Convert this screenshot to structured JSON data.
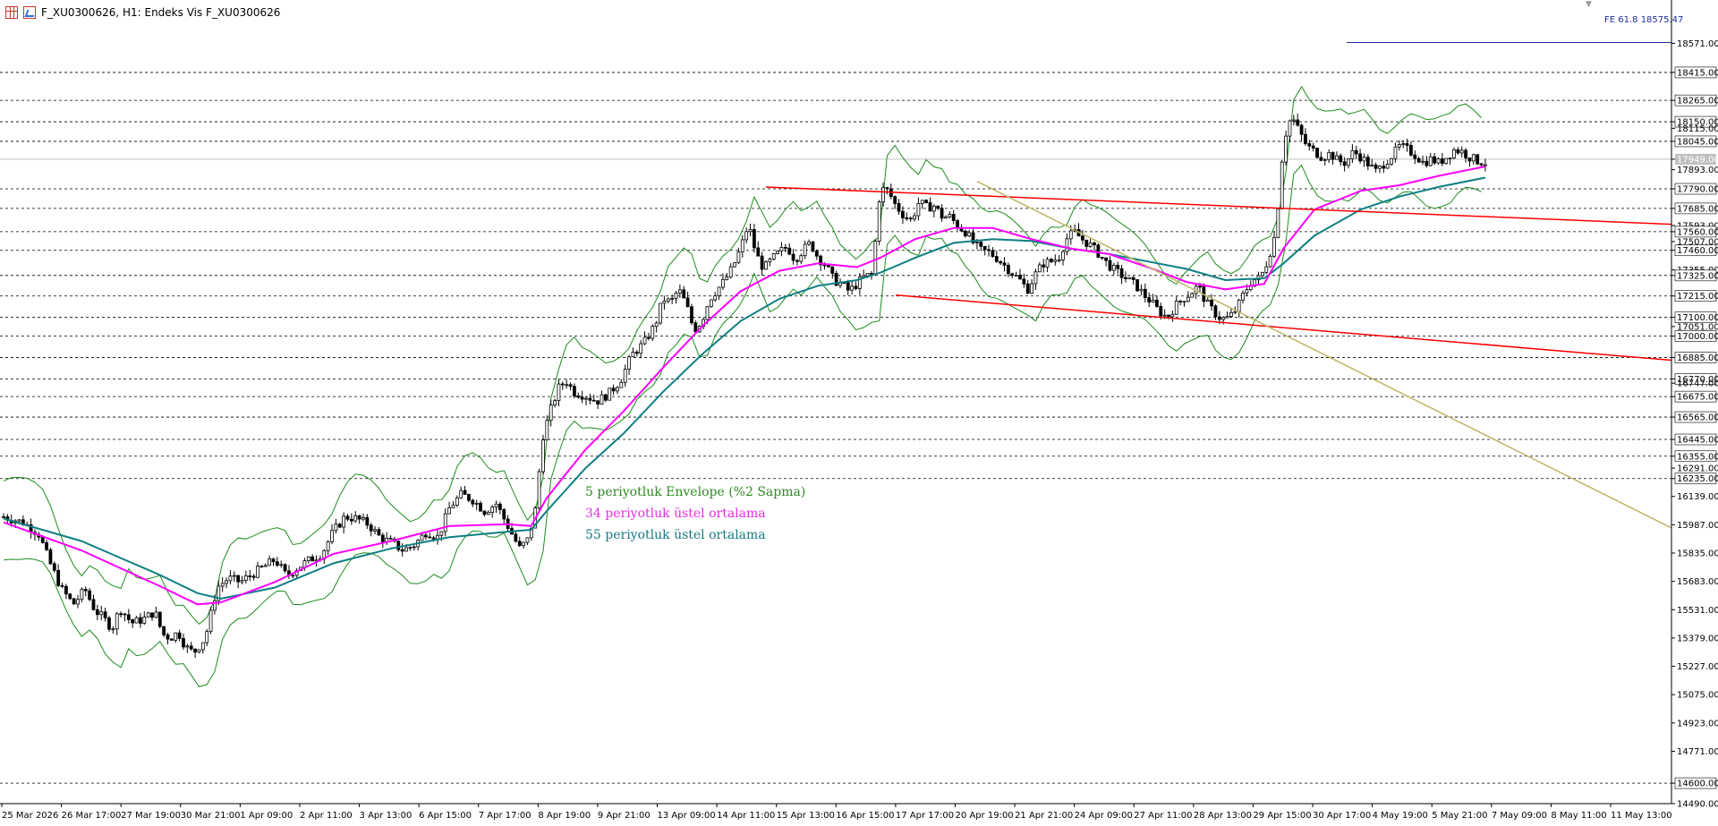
{
  "window": {
    "title": "F_XU0300626, H1:  Endeks Vis F_XU0300626",
    "scroll_marker": "▼"
  },
  "icons": {
    "grid": "grid-icon",
    "chart": "chart-icon"
  },
  "colors": {
    "background": "#ffffff",
    "candle": "#000000",
    "envelope": "#1e8c1e",
    "ema34": "#ff00ff",
    "ema55": "#0e7f84",
    "channel": "#ff0000",
    "trendline": "#bdb76b",
    "fibo": "#1f2ea3",
    "gridline": "#000000",
    "current_price_line": "#c0c0c0"
  },
  "fibo_label": "FE 61.8 18575.47",
  "legend": {
    "envelope": "5 periyotluk Envelope (%2 Sapma)",
    "ema34": "34 periyotluk üstel ortalama",
    "ema55": "55 periyotluk üstel ortalama"
  },
  "chart_data": {
    "type": "candlestick",
    "symbol": "F_XU0300626",
    "timeframe": "H1",
    "y_range": [
      14490,
      18650
    ],
    "y_ticks": [
      "18571.00",
      "18415.00",
      "18265.00",
      "18150.00",
      "18115.00",
      "18045.00",
      "17949.00",
      "17893.00",
      "17790.00",
      "17685.00",
      "17593.00",
      "17560.00",
      "17507.00",
      "17460.00",
      "17355.00",
      "17325.00",
      "17215.00",
      "17100.00",
      "17051.00",
      "17000.00",
      "16885.00",
      "16770.00",
      "16747.00",
      "16675.00",
      "16565.00",
      "16445.00",
      "16355.00",
      "16291.00",
      "16235.00",
      "16139.00",
      "15987.00",
      "15835.00",
      "15683.00",
      "15531.00",
      "15379.00",
      "15227.00",
      "15075.00",
      "14923.00",
      "14771.00",
      "14600.00",
      "14490.00"
    ],
    "level_lines": [
      18415,
      18265,
      18150,
      18045,
      17790,
      17685,
      17560,
      17460,
      17325,
      17215,
      17100,
      17000,
      16885,
      16770,
      16675,
      16565,
      16445,
      16355,
      16235,
      14600
    ],
    "current_price": 17949.0,
    "fibo_level": 18575.47,
    "x_labels": [
      "25 Mar 2026",
      "26 Mar 17:00",
      "27 Mar 19:00",
      "30 Mar 21:00",
      "1 Apr 09:00",
      "2 Apr 11:00",
      "3 Apr 13:00",
      "6 Apr 15:00",
      "7 Apr 17:00",
      "8 Apr 19:00",
      "9 Apr 21:00",
      "13 Apr 09:00",
      "14 Apr 11:00",
      "15 Apr 13:00",
      "16 Apr 15:00",
      "17 Apr 17:00",
      "20 Apr 19:00",
      "21 Apr 21:00",
      "24 Apr 09:00",
      "27 Apr 11:00",
      "28 Apr 13:00",
      "29 Apr 15:00",
      "30 Apr 17:00",
      "4 May 19:00",
      "5 May 21:00",
      "7 May 09:00",
      "8 May 11:00",
      "11 May 13:00"
    ],
    "price_path": [
      [
        0,
        16030
      ],
      [
        10,
        16000
      ],
      [
        18,
        15940
      ],
      [
        24,
        15780
      ],
      [
        30,
        15640
      ],
      [
        36,
        15560
      ],
      [
        42,
        15640
      ],
      [
        47,
        15530
      ],
      [
        52,
        15480
      ],
      [
        56,
        15430
      ],
      [
        60,
        15540
      ],
      [
        66,
        15460
      ],
      [
        72,
        15480
      ],
      [
        78,
        15520
      ],
      [
        82,
        15400
      ],
      [
        86,
        15380
      ],
      [
        90,
        15410
      ],
      [
        94,
        15330
      ],
      [
        98,
        15300
      ],
      [
        104,
        15380
      ],
      [
        110,
        15650
      ],
      [
        116,
        15700
      ],
      [
        122,
        15680
      ],
      [
        128,
        15720
      ],
      [
        134,
        15760
      ],
      [
        140,
        15800
      ],
      [
        146,
        15710
      ],
      [
        152,
        15760
      ],
      [
        158,
        15800
      ],
      [
        164,
        15830
      ],
      [
        170,
        15950
      ],
      [
        176,
        16030
      ],
      [
        182,
        16020
      ],
      [
        188,
        15990
      ],
      [
        194,
        15920
      ],
      [
        200,
        15890
      ],
      [
        206,
        15850
      ],
      [
        212,
        15880
      ],
      [
        218,
        15950
      ],
      [
        224,
        15920
      ],
      [
        230,
        16080
      ],
      [
        236,
        16150
      ],
      [
        242,
        16120
      ],
      [
        248,
        16060
      ],
      [
        254,
        16100
      ],
      [
        258,
        16020
      ],
      [
        262,
        15940
      ],
      [
        266,
        15860
      ],
      [
        270,
        15900
      ],
      [
        274,
        16050
      ],
      [
        278,
        16460
      ],
      [
        282,
        16600
      ],
      [
        286,
        16720
      ],
      [
        290,
        16760
      ],
      [
        294,
        16700
      ],
      [
        300,
        16680
      ],
      [
        306,
        16650
      ],
      [
        312,
        16690
      ],
      [
        318,
        16760
      ],
      [
        324,
        16900
      ],
      [
        330,
        16960
      ],
      [
        336,
        17060
      ],
      [
        340,
        17200
      ],
      [
        344,
        17180
      ],
      [
        348,
        17250
      ],
      [
        352,
        17170
      ],
      [
        356,
        17030
      ],
      [
        360,
        17080
      ],
      [
        364,
        17200
      ],
      [
        368,
        17250
      ],
      [
        372,
        17300
      ],
      [
        376,
        17370
      ],
      [
        380,
        17470
      ],
      [
        384,
        17600
      ],
      [
        388,
        17440
      ],
      [
        392,
        17360
      ],
      [
        396,
        17410
      ],
      [
        400,
        17450
      ],
      [
        404,
        17480
      ],
      [
        408,
        17410
      ],
      [
        412,
        17460
      ],
      [
        416,
        17500
      ],
      [
        420,
        17420
      ],
      [
        424,
        17380
      ],
      [
        428,
        17300
      ],
      [
        432,
        17280
      ],
      [
        436,
        17240
      ],
      [
        440,
        17280
      ],
      [
        444,
        17320
      ],
      [
        448,
        17330
      ],
      [
        452,
        17790
      ],
      [
        456,
        17780
      ],
      [
        460,
        17700
      ],
      [
        464,
        17650
      ],
      [
        468,
        17620
      ],
      [
        472,
        17720
      ],
      [
        476,
        17690
      ],
      [
        480,
        17700
      ],
      [
        484,
        17640
      ],
      [
        488,
        17640
      ],
      [
        492,
        17590
      ],
      [
        496,
        17560
      ],
      [
        500,
        17500
      ],
      [
        504,
        17460
      ],
      [
        508,
        17450
      ],
      [
        512,
        17420
      ],
      [
        516,
        17380
      ],
      [
        520,
        17340
      ],
      [
        524,
        17300
      ],
      [
        528,
        17250
      ],
      [
        532,
        17330
      ],
      [
        536,
        17390
      ],
      [
        540,
        17400
      ],
      [
        544,
        17420
      ],
      [
        548,
        17520
      ],
      [
        552,
        17560
      ],
      [
        556,
        17520
      ],
      [
        560,
        17490
      ],
      [
        564,
        17450
      ],
      [
        568,
        17400
      ],
      [
        572,
        17360
      ],
      [
        576,
        17330
      ],
      [
        580,
        17300
      ],
      [
        584,
        17270
      ],
      [
        588,
        17220
      ],
      [
        592,
        17180
      ],
      [
        596,
        17130
      ],
      [
        600,
        17100
      ],
      [
        604,
        17160
      ],
      [
        608,
        17200
      ],
      [
        612,
        17230
      ],
      [
        616,
        17270
      ],
      [
        620,
        17180
      ],
      [
        624,
        17130
      ],
      [
        628,
        17090
      ],
      [
        632,
        17100
      ],
      [
        636,
        17150
      ],
      [
        640,
        17240
      ],
      [
        644,
        17300
      ],
      [
        648,
        17310
      ],
      [
        652,
        17410
      ],
      [
        656,
        17560
      ],
      [
        660,
        18050
      ],
      [
        664,
        18180
      ],
      [
        668,
        18100
      ],
      [
        672,
        18020
      ],
      [
        676,
        17990
      ],
      [
        680,
        17960
      ],
      [
        684,
        17980
      ],
      [
        688,
        17940
      ],
      [
        692,
        17930
      ],
      [
        696,
        17990
      ],
      [
        700,
        17960
      ],
      [
        704,
        17920
      ],
      [
        708,
        17880
      ],
      [
        712,
        17930
      ],
      [
        716,
        17970
      ],
      [
        720,
        18020
      ],
      [
        724,
        18000
      ],
      [
        728,
        17970
      ],
      [
        732,
        17930
      ],
      [
        736,
        17950
      ],
      [
        740,
        17930
      ],
      [
        744,
        17960
      ],
      [
        748,
        18000
      ],
      [
        752,
        17990
      ],
      [
        756,
        17960
      ],
      [
        760,
        17940
      ],
      [
        764,
        17930
      ]
    ],
    "ema34_path": [
      [
        0,
        16000
      ],
      [
        40,
        15850
      ],
      [
        80,
        15660
      ],
      [
        100,
        15560
      ],
      [
        112,
        15570
      ],
      [
        140,
        15680
      ],
      [
        170,
        15830
      ],
      [
        200,
        15900
      ],
      [
        230,
        15980
      ],
      [
        260,
        15990
      ],
      [
        272,
        15980
      ],
      [
        280,
        16130
      ],
      [
        300,
        16390
      ],
      [
        320,
        16600
      ],
      [
        340,
        16830
      ],
      [
        360,
        17050
      ],
      [
        380,
        17240
      ],
      [
        400,
        17350
      ],
      [
        420,
        17390
      ],
      [
        440,
        17370
      ],
      [
        452,
        17420
      ],
      [
        470,
        17520
      ],
      [
        490,
        17580
      ],
      [
        510,
        17580
      ],
      [
        530,
        17520
      ],
      [
        550,
        17470
      ],
      [
        570,
        17440
      ],
      [
        590,
        17370
      ],
      [
        610,
        17290
      ],
      [
        630,
        17250
      ],
      [
        650,
        17280
      ],
      [
        660,
        17470
      ],
      [
        676,
        17680
      ],
      [
        700,
        17780
      ],
      [
        720,
        17810
      ],
      [
        740,
        17860
      ],
      [
        764,
        17910
      ]
    ],
    "ema55_path": [
      [
        0,
        16020
      ],
      [
        40,
        15900
      ],
      [
        80,
        15720
      ],
      [
        100,
        15620
      ],
      [
        112,
        15590
      ],
      [
        140,
        15650
      ],
      [
        170,
        15780
      ],
      [
        200,
        15860
      ],
      [
        230,
        15920
      ],
      [
        260,
        15950
      ],
      [
        272,
        15960
      ],
      [
        280,
        16060
      ],
      [
        300,
        16290
      ],
      [
        320,
        16480
      ],
      [
        340,
        16700
      ],
      [
        360,
        16900
      ],
      [
        380,
        17080
      ],
      [
        400,
        17200
      ],
      [
        420,
        17270
      ],
      [
        440,
        17300
      ],
      [
        452,
        17340
      ],
      [
        470,
        17420
      ],
      [
        490,
        17500
      ],
      [
        510,
        17520
      ],
      [
        530,
        17510
      ],
      [
        550,
        17470
      ],
      [
        570,
        17440
      ],
      [
        590,
        17400
      ],
      [
        610,
        17360
      ],
      [
        630,
        17300
      ],
      [
        650,
        17310
      ],
      [
        660,
        17390
      ],
      [
        676,
        17540
      ],
      [
        700,
        17680
      ],
      [
        720,
        17750
      ],
      [
        740,
        17800
      ],
      [
        764,
        17850
      ]
    ],
    "channel_upper": [
      [
        17800,
        393
      ],
      [
        17600,
        760
      ]
    ],
    "channel_lower": [
      [
        17220,
        460
      ],
      [
        16870,
        760
      ]
    ],
    "trendline": [
      [
        17830,
        502
      ],
      [
        15970,
        780
      ]
    ]
  }
}
